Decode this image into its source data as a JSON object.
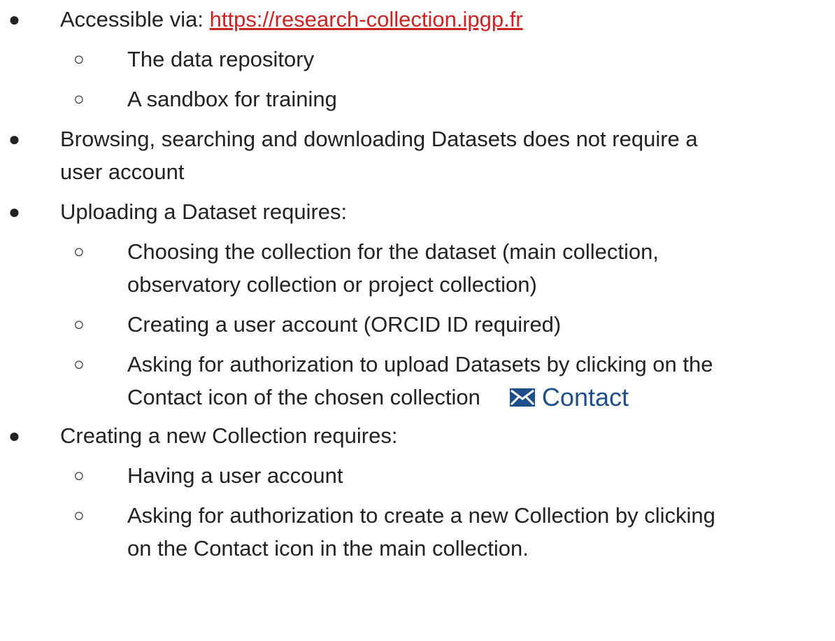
{
  "bullets": {
    "b1": {
      "prefix": "Accessible via: ",
      "link_text": "https://research-collection.ipgp.fr",
      "sub": [
        "The data repository",
        "A sandbox for training"
      ]
    },
    "b2": {
      "line1": "Browsing, searching and downloading Datasets does not require a",
      "line2": "user account"
    },
    "b3": {
      "text": "Uploading a Dataset requires:",
      "sub1_line1": "Choosing the collection for the dataset (main collection,",
      "sub1_line2": "observatory collection or project collection)",
      "sub2": "Creating a user account (ORCID ID required)",
      "sub3_line1": "Asking for authorization to upload Datasets by clicking on the",
      "sub3_line2": "Contact icon of the chosen collection"
    },
    "b4": {
      "text": "Creating a new Collection requires:",
      "sub1": "Having a user account",
      "sub2_line1": "Asking for authorization to create a new Collection by clicking",
      "sub2_line2": "on the Contact icon in the main collection."
    }
  },
  "contact_button": {
    "label": "Contact",
    "icon": "envelope-icon",
    "color": "#1f4f8a"
  },
  "colors": {
    "text": "#222222",
    "link": "#cc2222"
  }
}
